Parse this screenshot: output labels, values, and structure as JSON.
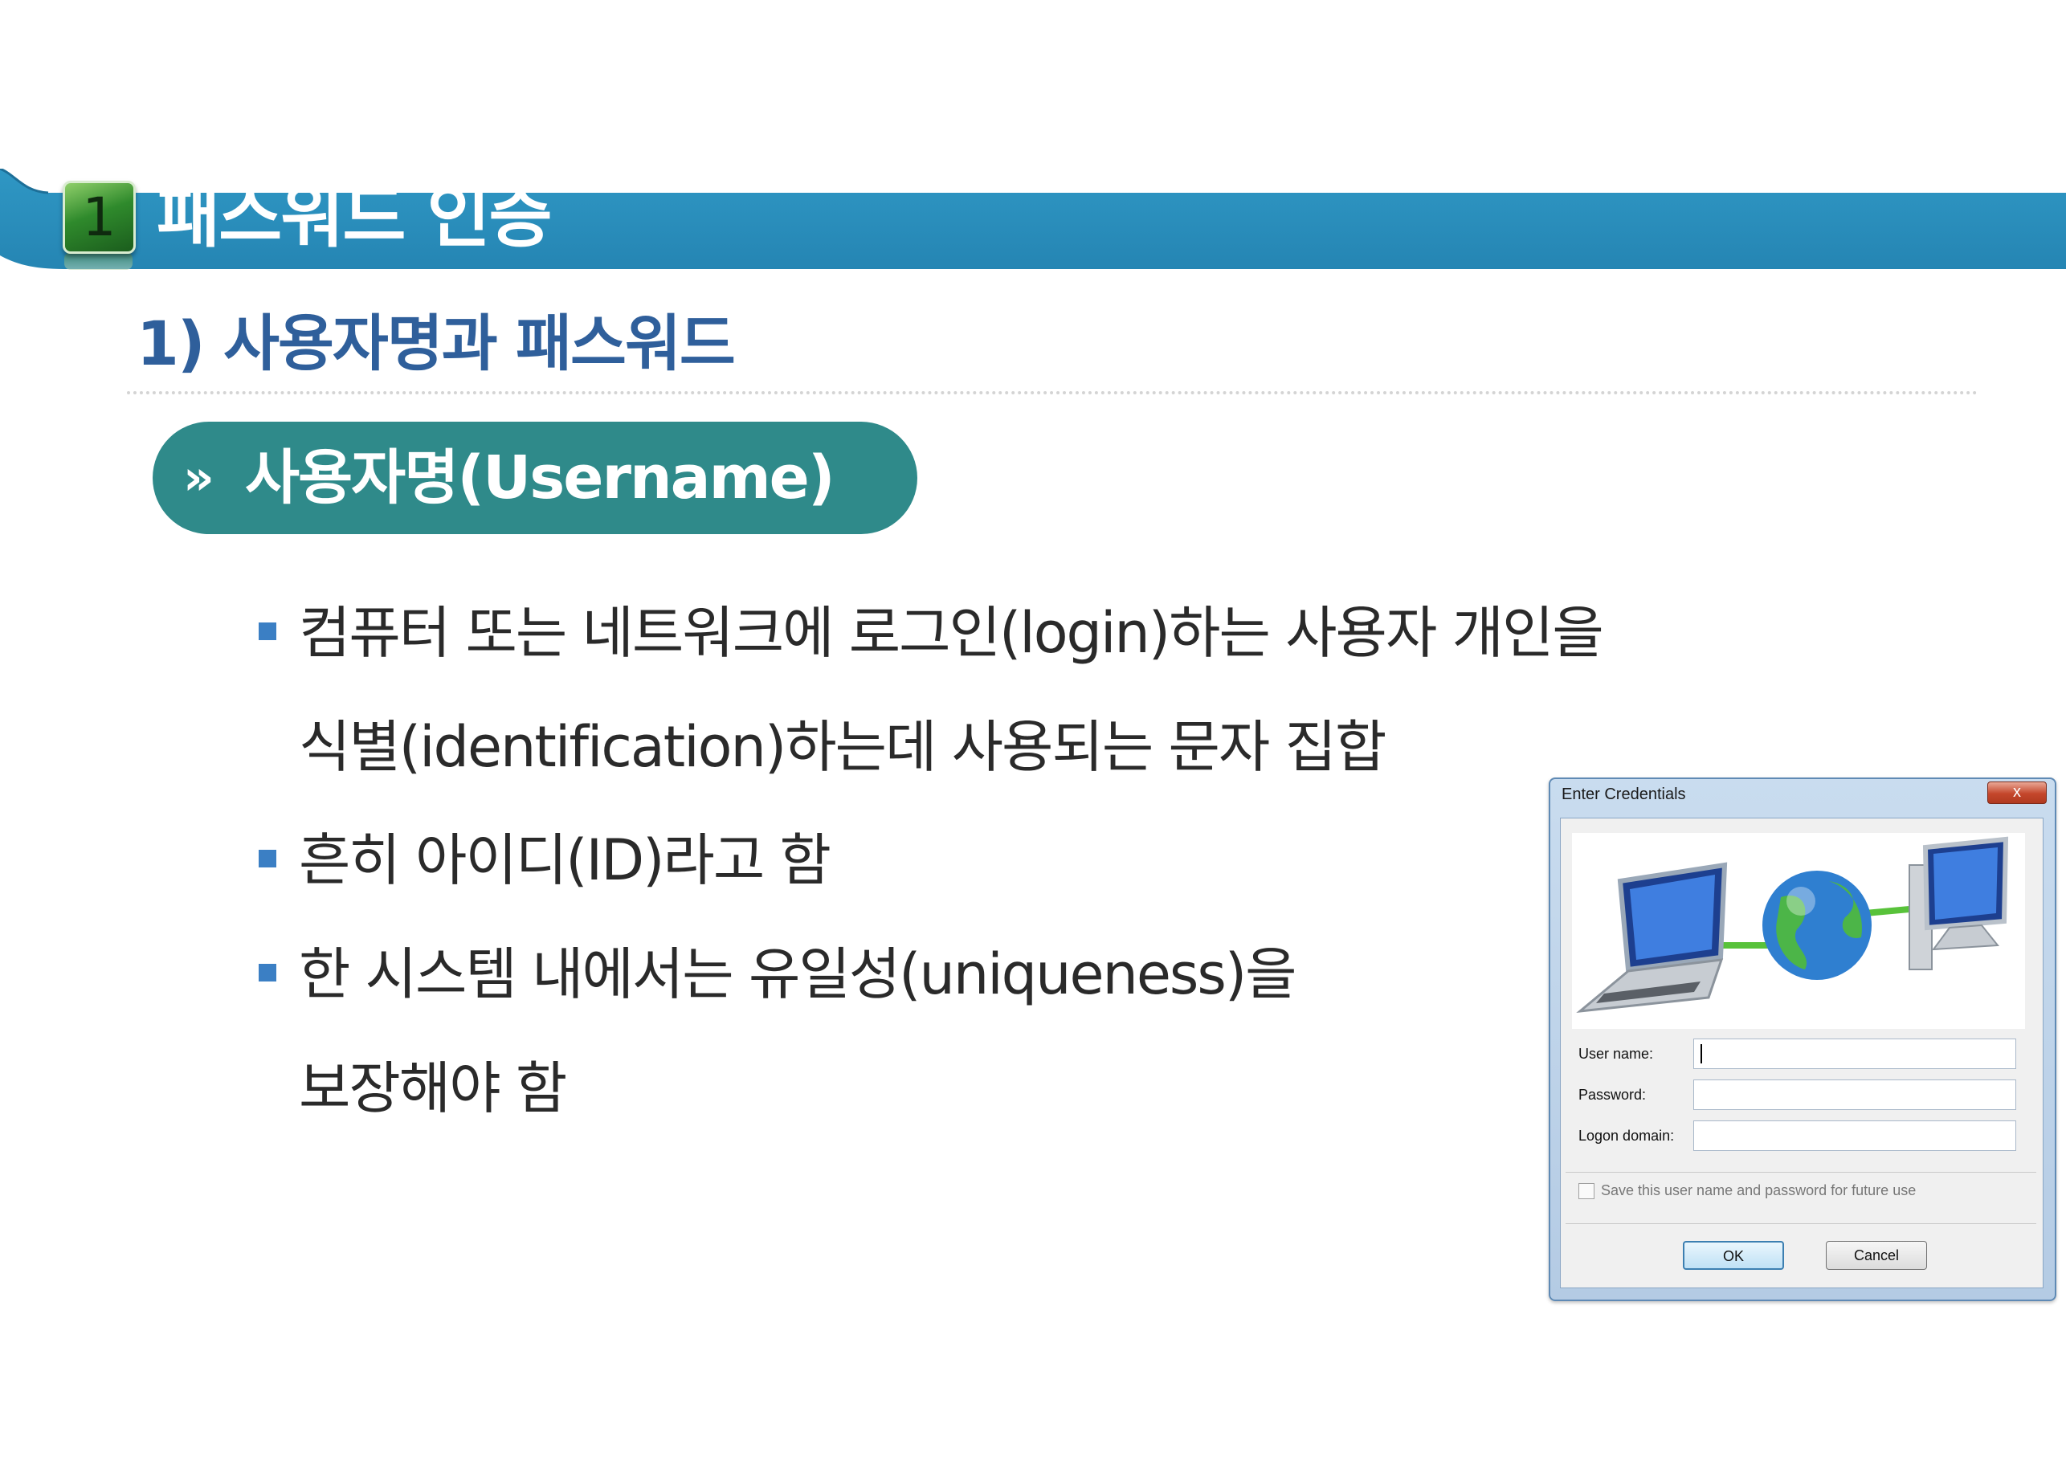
{
  "header": {
    "number": "1",
    "title": "패스워드 인증"
  },
  "section": {
    "title": "1) 사용자명과 패스워드"
  },
  "pill": {
    "icon": "»",
    "label": "사용자명(Username)"
  },
  "bullets": [
    {
      "lines": [
        "컴퓨터 또는 네트워크에 로그인(login)하는 사용자 개인을",
        "식별(identification)하는데 사용되는 문자 집합"
      ]
    },
    {
      "lines": [
        "흔히 아이디(ID)라고 함"
      ]
    },
    {
      "lines": [
        "한 시스템 내에서는 유일성(uniqueness)을",
        "보장해야 함"
      ]
    }
  ],
  "dialog": {
    "title": "Enter Credentials",
    "close_label": "x",
    "fields": [
      {
        "label": "User name:",
        "value": ""
      },
      {
        "label": "Password:",
        "value": ""
      },
      {
        "label": "Logon domain:",
        "value": ""
      }
    ],
    "checkbox_label": "Save this user name and password for future use",
    "ok_label": "OK",
    "cancel_label": "Cancel"
  },
  "colors": {
    "header_bar": "#2a8fbd",
    "section_title": "#2f5f9b",
    "pill": "#2f8a8a",
    "bullet": "#3b7fc4"
  }
}
